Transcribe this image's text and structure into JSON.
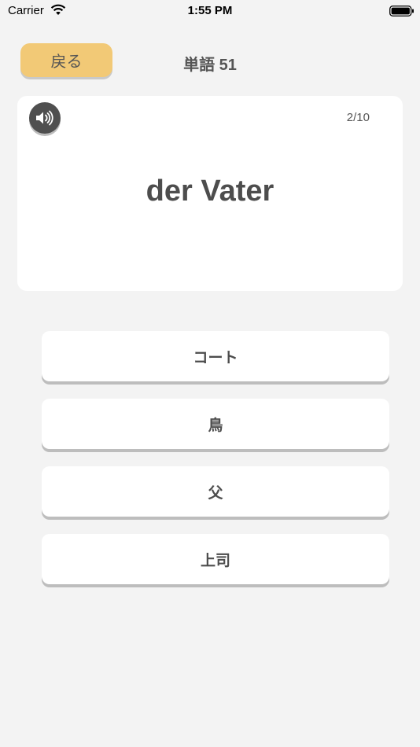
{
  "status_bar": {
    "carrier": "Carrier",
    "time": "1:55 PM",
    "wifi_icon": "wifi-icon",
    "battery_icon": "battery-icon"
  },
  "header": {
    "back_label": "戻る",
    "title": "単語 51"
  },
  "card": {
    "speaker_icon": "speaker-icon",
    "counter": "2/10",
    "word": "der Vater"
  },
  "options": [
    {
      "label": "コート"
    },
    {
      "label": "鳥"
    },
    {
      "label": "父"
    },
    {
      "label": "上司"
    }
  ],
  "colors": {
    "background": "#f3f3f3",
    "back_button": "#f2c976",
    "speaker_button": "#4f4f4f",
    "card": "#ffffff",
    "text": "#4d4d4d"
  }
}
